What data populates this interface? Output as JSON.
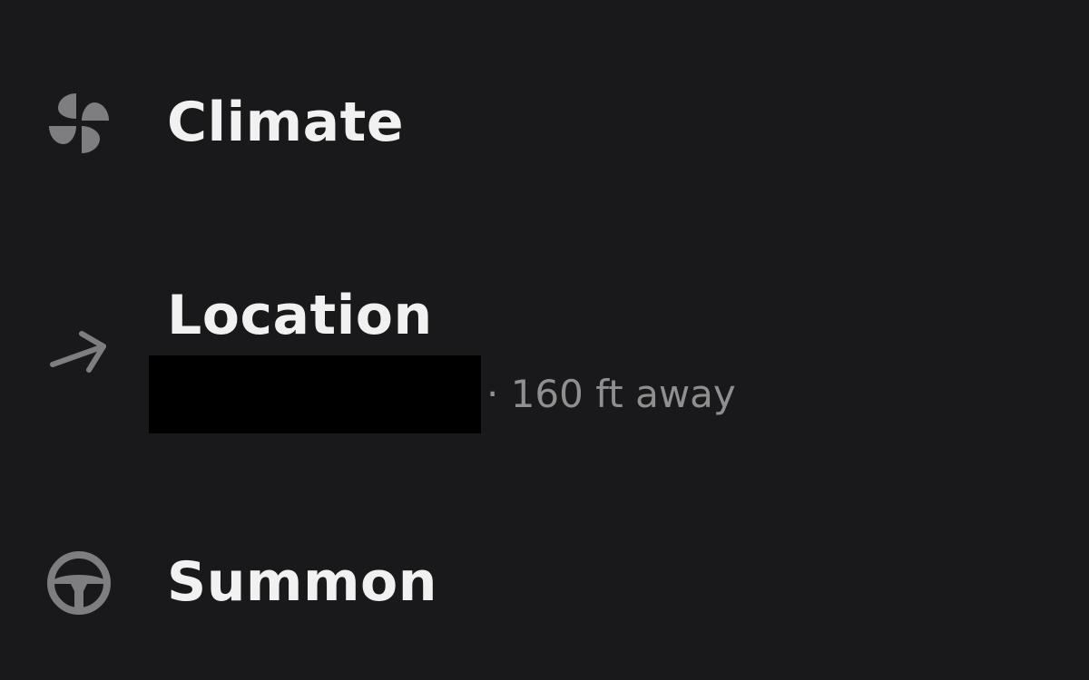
{
  "menu": {
    "items": [
      {
        "label": "Climate",
        "icon": "fan-icon"
      },
      {
        "label": "Location",
        "icon": "arrow-right-icon",
        "detail": "· 160 ft away"
      },
      {
        "label": "Summon",
        "icon": "steering-wheel-icon"
      }
    ]
  },
  "colors": {
    "background": "#19191b",
    "label": "#f1f1f1",
    "icon": "#7e7e80",
    "secondary_text": "#8f8f90",
    "redaction": "#000000"
  }
}
